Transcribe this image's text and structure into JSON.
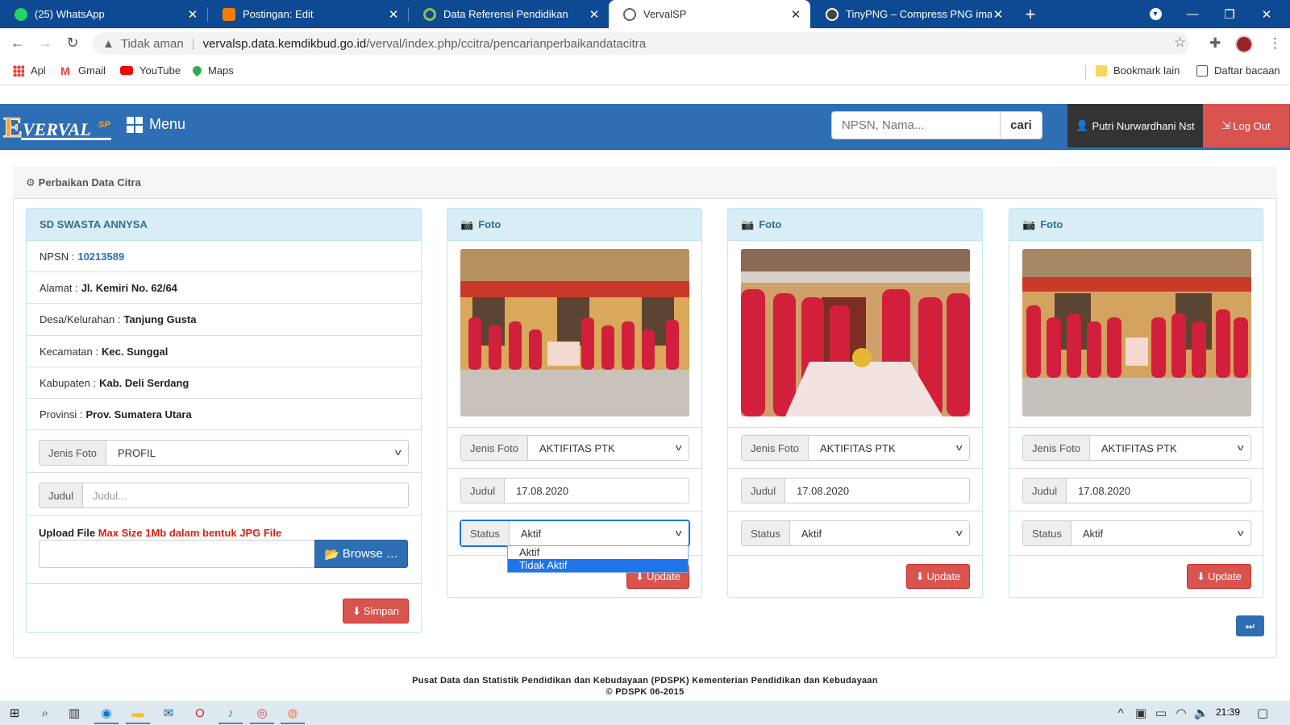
{
  "browser": {
    "tabs": [
      {
        "title": "(25) WhatsApp",
        "icon": "whatsapp-icon",
        "color": "#25d366"
      },
      {
        "title": "Postingan: Edit",
        "icon": "blogger-icon",
        "color": "#f57d00"
      },
      {
        "title": "Data Referensi Pendidikan",
        "icon": "refresh-circle-icon",
        "color": "#8bc34a"
      },
      {
        "title": "VervalSP",
        "icon": "globe-icon",
        "color": "#5f6368"
      },
      {
        "title": "TinyPNG – Compress PNG images",
        "icon": "panda-icon",
        "color": "#444"
      }
    ],
    "active_tab": 3,
    "address": {
      "security_label": "Tidak aman",
      "host": "vervalsp.data.kemdikbud.go.id",
      "path": "/verval/index.php/ccitra/pencarianperbaikandatacitra"
    },
    "bookmarks": [
      {
        "label": "Apl",
        "icon": "apps-grid-icon"
      },
      {
        "label": "Gmail",
        "icon": "gmail-icon"
      },
      {
        "label": "YouTube",
        "icon": "youtube-icon"
      },
      {
        "label": "Maps",
        "icon": "maps-pin-icon"
      }
    ],
    "bookmarks_right": [
      {
        "label": "Bookmark lain",
        "icon": "folder-icon"
      },
      {
        "label": "Daftar bacaan",
        "icon": "reading-list-icon"
      }
    ]
  },
  "header": {
    "logo_text": "EVERVALSP",
    "menu_label": "Menu",
    "search_placeholder": "NPSN, Nama...",
    "search_button": "cari",
    "user_name": "Putri Nurwardhani Nst",
    "logout_label": "Log Out"
  },
  "panel": {
    "title": "Perbaikan Data Citra"
  },
  "school": {
    "name": "SD SWASTA ANNYSA",
    "fields": [
      {
        "label": "NPSN :",
        "value": "10213589"
      },
      {
        "label": "Alamat :",
        "value": "Jl. Kemiri No. 62/64"
      },
      {
        "label": "Desa/Kelurahan :",
        "value": "Tanjung Gusta"
      },
      {
        "label": "Kecamatan :",
        "value": "Kec. Sunggal"
      },
      {
        "label": "Kabupaten :",
        "value": "Kab. Deli Serdang"
      },
      {
        "label": "Provinsi :",
        "value": "Prov. Sumatera Utara"
      }
    ],
    "jenis_foto_label": "Jenis Foto",
    "jenis_foto_value": "PROFIL",
    "judul_label": "Judul",
    "judul_placeholder": "Judul...",
    "upload_label": "Upload File",
    "upload_note": "Max Size 1Mb dalam bentuk JPG File",
    "browse_label": "Browse …",
    "save_label": "Simpan"
  },
  "photos": [
    {
      "header": "Foto",
      "jenis_label": "Jenis Foto",
      "jenis_value": "AKTIFITAS PTK",
      "judul_label": "Judul",
      "judul_value": "17.08.2020",
      "status_label": "Status",
      "status_value": "Aktif",
      "update_label": "Update"
    },
    {
      "header": "Foto",
      "jenis_label": "Jenis Foto",
      "jenis_value": "AKTIFITAS PTK",
      "judul_label": "Judul",
      "judul_value": "17.08.2020",
      "status_label": "Status",
      "status_value": "Aktif",
      "update_label": "Update"
    },
    {
      "header": "Foto",
      "jenis_label": "Jenis Foto",
      "jenis_value": "AKTIFITAS PTK",
      "judul_label": "Judul",
      "judul_value": "17.08.2020",
      "status_label": "Status",
      "status_value": "Aktif",
      "update_label": "Update"
    }
  ],
  "status_dropdown": {
    "options": [
      "Aktif",
      "Tidak Aktif"
    ],
    "highlighted": "Tidak Aktif"
  },
  "footer": {
    "line1": "Pusat Data dan Statistik Pendidikan dan Kebudayaan (PDSPK) Kementerian Pendidikan dan Kebudayaan",
    "line2": "© PDSPK 06-2015"
  },
  "taskbar": {
    "time": "21:39"
  },
  "colors": {
    "tabbar": "#0d4a93",
    "site_header": "#2d6eb5",
    "danger": "#d9534f",
    "info_header": "#d9edf7"
  }
}
